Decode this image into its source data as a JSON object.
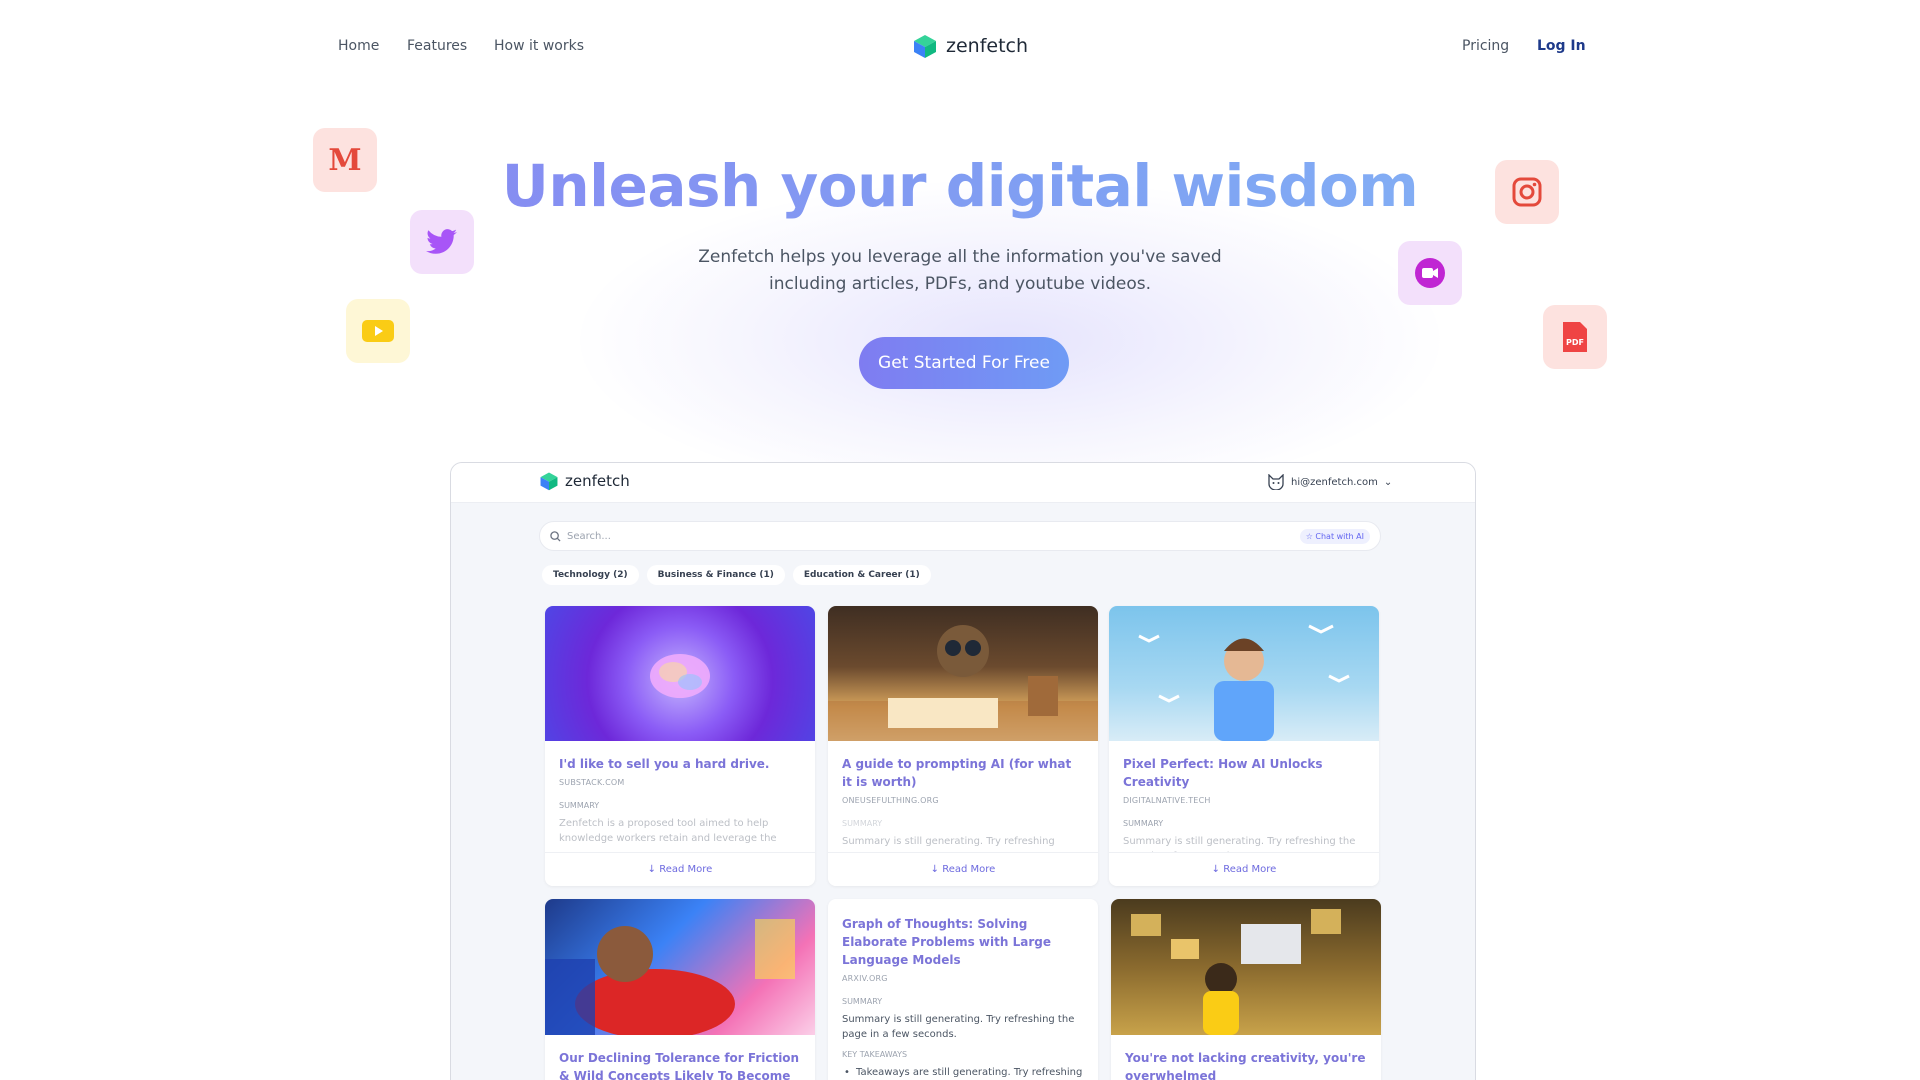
{
  "nav": {
    "home": "Home",
    "features": "Features",
    "how": "How it works",
    "brand": "zenfetch",
    "pricing": "Pricing",
    "login": "Log In"
  },
  "hero": {
    "title": "Unleash your digital wisdom",
    "subtitle_line1": "Zenfetch helps you leverage all the information you've saved",
    "subtitle_line2": "including articles, PDFs, and youtube videos.",
    "cta": "Get Started For Free"
  },
  "floating_icons": [
    "medium-icon",
    "twitter-icon",
    "youtube-icon",
    "instagram-icon",
    "video-call-icon",
    "pdf-icon"
  ],
  "app": {
    "brand": "zenfetch",
    "user_email": "hi@zenfetch.com",
    "search_placeholder": "Search...",
    "chat_label": "☆ Chat with AI",
    "chips": [
      "Technology (2)",
      "Business & Finance (1)",
      "Education & Career (1)"
    ],
    "cards": [
      {
        "title": "I'd like to sell you a hard drive.",
        "source": "SUBSTACK.COM",
        "summary_label": "SUMMARY",
        "summary": "Zenfetch is a proposed tool aimed to help knowledge workers retain and leverage the",
        "read_more": "↓ Read More"
      },
      {
        "title": "A guide to prompting AI (for what it is worth)",
        "source": "ONEUSEFULTHING.ORG",
        "summary_label": "SUMMARY",
        "summary": "Summary is still generating. Try refreshing",
        "read_more": "↓ Read More"
      },
      {
        "title": "Pixel Perfect: How AI Unlocks Creativity",
        "source": "DIGITALNATIVE.TECH",
        "summary_label": "SUMMARY",
        "summary": "Summary is still generating. Try refreshing the page in a few seconds.",
        "read_more": "↓ Read More"
      },
      {
        "title": "Our Declining Tolerance for Friction & Wild Concepts Likely To Become"
      },
      {
        "title": "Graph of Thoughts: Solving Elaborate Problems with Large Language Models",
        "source": "ARXIV.ORG",
        "summary_label": "SUMMARY",
        "summary": "Summary is still generating. Try refreshing the page in a few seconds.",
        "takeaways_label": "KEY TAKEAWAYS",
        "takeaway": "Takeaways are still generating. Try refreshing the page in a few seconds."
      },
      {
        "title": "You're not lacking creativity, you're overwhelmed"
      }
    ]
  },
  "colors": {
    "accent": "#7f7cf1",
    "title_gradient_start": "#8b7df0",
    "title_gradient_end": "#8ac0f6",
    "login": "#1e3a8a"
  }
}
